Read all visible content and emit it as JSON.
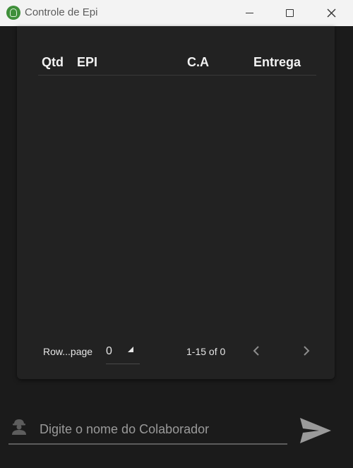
{
  "window": {
    "title": "Controle de Epi",
    "icon": "app-logo-icon",
    "controls": [
      "minimize-icon",
      "maximize-icon",
      "close-icon"
    ]
  },
  "table": {
    "columns": [
      "Qtd",
      "EPI",
      "C.A",
      "Entrega"
    ],
    "rows": []
  },
  "pagination": {
    "rows_per_page_label": "Row...page",
    "rows_per_page_value": "0",
    "range_text": "1-15 of 0",
    "prev_icon": "chevron-left-icon",
    "next_icon": "chevron-right-icon"
  },
  "search": {
    "placeholder": "Digite o nome do Colaborador",
    "value": "",
    "leading_icon": "worker-icon",
    "submit_icon": "send-icon"
  },
  "colors": {
    "background": "#1b1b1b",
    "card": "#222222",
    "titlebar": "#f3f3f3",
    "text": "#f2f2f2",
    "muted": "#9a9a9a"
  }
}
